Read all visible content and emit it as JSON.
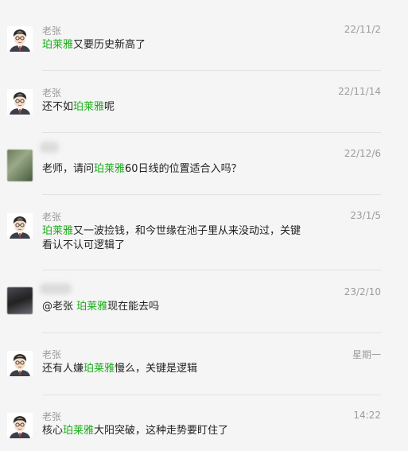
{
  "messages": [
    {
      "sender": "老张",
      "time": "22/11/2",
      "pre": "",
      "stock": "珀莱雅",
      "post": "又要历史新高了"
    },
    {
      "sender": "老张",
      "time": "22/11/14",
      "pre": "还不如",
      "stock": "珀莱雅",
      "post": "呢"
    },
    {
      "sender": "",
      "time": "22/12/6",
      "pre": "老师，请问",
      "stock": "珀莱雅",
      "post": "60日线的位置适合入吗？"
    },
    {
      "sender": "老张",
      "time": "23/1/5",
      "pre": "",
      "stock": "珀莱雅",
      "post": "又一波捡钱，和今世缘在池子里从来没动过，关键",
      "line2": "看认不认可逻辑了"
    },
    {
      "sender": "",
      "time": "23/2/10",
      "pre": "@老张 ",
      "stock": "珀莱雅",
      "post": "现在能去吗"
    },
    {
      "sender": "老张",
      "time": "星期一",
      "pre": "还有人嫌",
      "stock": "珀莱雅",
      "post": "慢么，关键是逻辑"
    },
    {
      "sender": "老张",
      "time": "14:22",
      "pre": "核心",
      "stock": "珀莱雅",
      "post": "大阳突破，这种走势要盯住了"
    }
  ],
  "colors": {
    "stock_highlight": "#1aad19",
    "background": "#f5f5f5"
  },
  "icons": {
    "avatar_teacher": "cartoon-man-glasses-icon"
  }
}
